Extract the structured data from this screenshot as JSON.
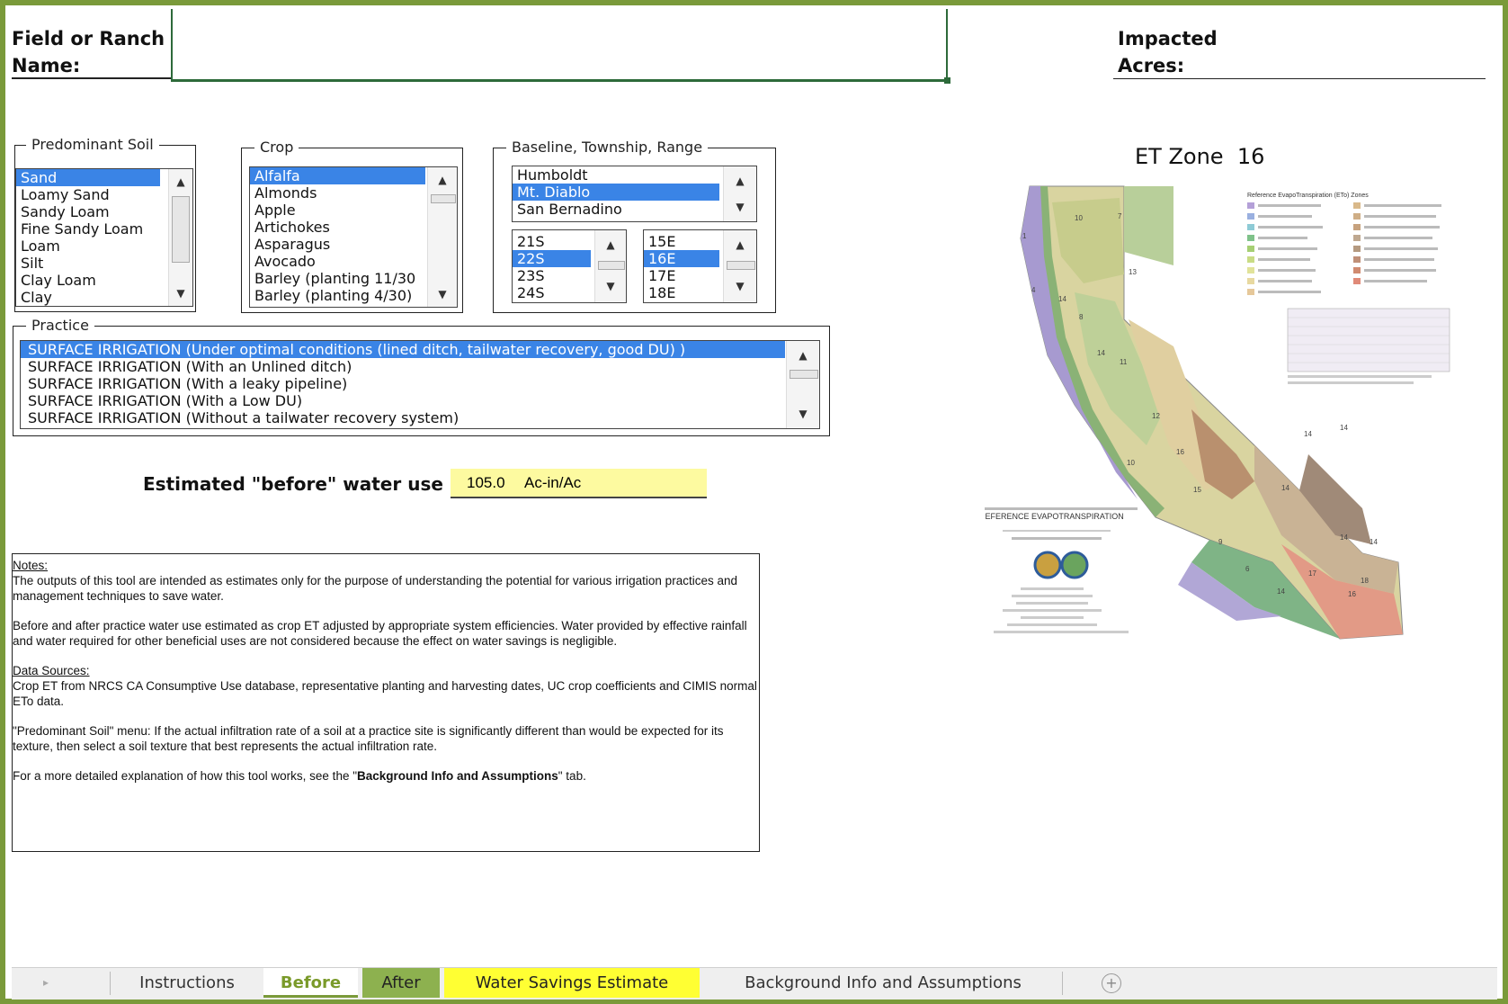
{
  "header": {
    "field_label_line1": "Field or Ranch",
    "field_label_line2": "Name:",
    "acres_label_line1": "Impacted",
    "acres_label_line2": "Acres:"
  },
  "soil": {
    "legend": "Predominant Soil",
    "items": [
      "Sand",
      "Loamy Sand",
      "Sandy Loam",
      "Fine Sandy Loam",
      "Loam",
      "Silt",
      "Clay Loam",
      "Clay"
    ],
    "selected": "Sand"
  },
  "crop": {
    "legend": "Crop",
    "items": [
      "Alfalfa",
      "Almonds",
      "Apple",
      "Artichokes",
      "Asparagus",
      "Avocado",
      "Barley (planting 11/30",
      "Barley (planting 4/30)"
    ],
    "selected": "Alfalfa"
  },
  "btr": {
    "legend": "Baseline, Township, Range",
    "baselines": [
      "Humboldt",
      "Mt. Diablo",
      "San Bernadino"
    ],
    "baseline_selected": "Mt. Diablo",
    "townships": [
      "21S",
      "22S",
      "23S",
      "24S"
    ],
    "township_selected": "22S",
    "ranges": [
      "15E",
      "16E",
      "17E",
      "18E"
    ],
    "range_selected": "16E"
  },
  "practice": {
    "legend": "Practice",
    "items": [
      "SURFACE IRRIGATION (Under optimal conditions (lined ditch, tailwater recovery, good DU) )",
      "SURFACE IRRIGATION (With an Unlined ditch)",
      "SURFACE IRRIGATION (With a leaky pipeline)",
      "SURFACE IRRIGATION (With a Low DU)",
      "SURFACE IRRIGATION (Without a tailwater recovery system)"
    ],
    "selected_index": 0
  },
  "estimate": {
    "label": "Estimated \"before\" water use",
    "value": "105.0",
    "unit": "Ac-in/Ac"
  },
  "et_zone": {
    "title": "ET Zone",
    "value": "16",
    "map_caption": "REFERENCE EVAPOTRANSPIRATION",
    "legend_title": "Reference EvapoTranspiration (ETo) Zones"
  },
  "notes": {
    "heading": "Notes:",
    "p1": "The outputs of this tool are intended as estimates only for the purpose of understanding the potential for various irrigation practices and management techniques to save water.",
    "p2": "Before and after practice water use estimated as crop ET adjusted by appropriate system efficiencies.  Water provided by effective rainfall and water required for other beneficial uses are not considered because the effect on water savings is negligible.",
    "sources_heading": "Data Sources:",
    "p3": "Crop ET from NRCS CA Consumptive Use database, representative planting and harvesting dates, UC crop coefficients and CIMIS normal ETo data.",
    "p4": "\"Predominant Soil\" menu:  If the actual infiltration rate of a soil at a practice site is significantly different than would be expected for its texture, then select a soil texture that best represents the actual infiltration rate.",
    "p5_pre": "For a more detailed explanation of how this tool works, see the \"",
    "p5_bold": "Background Info and Assumptions",
    "p5_post": "\" tab."
  },
  "tabs": [
    "Instructions",
    "Before",
    "After",
    "Water Savings Estimate",
    "Background Info and Assumptions"
  ],
  "colors": {
    "frame": "#7a9a3a",
    "selection": "#3a84e6",
    "estimate_bg": "#fdfaa0",
    "tab_after": "#8db14f",
    "tab_water": "#ffff33"
  }
}
